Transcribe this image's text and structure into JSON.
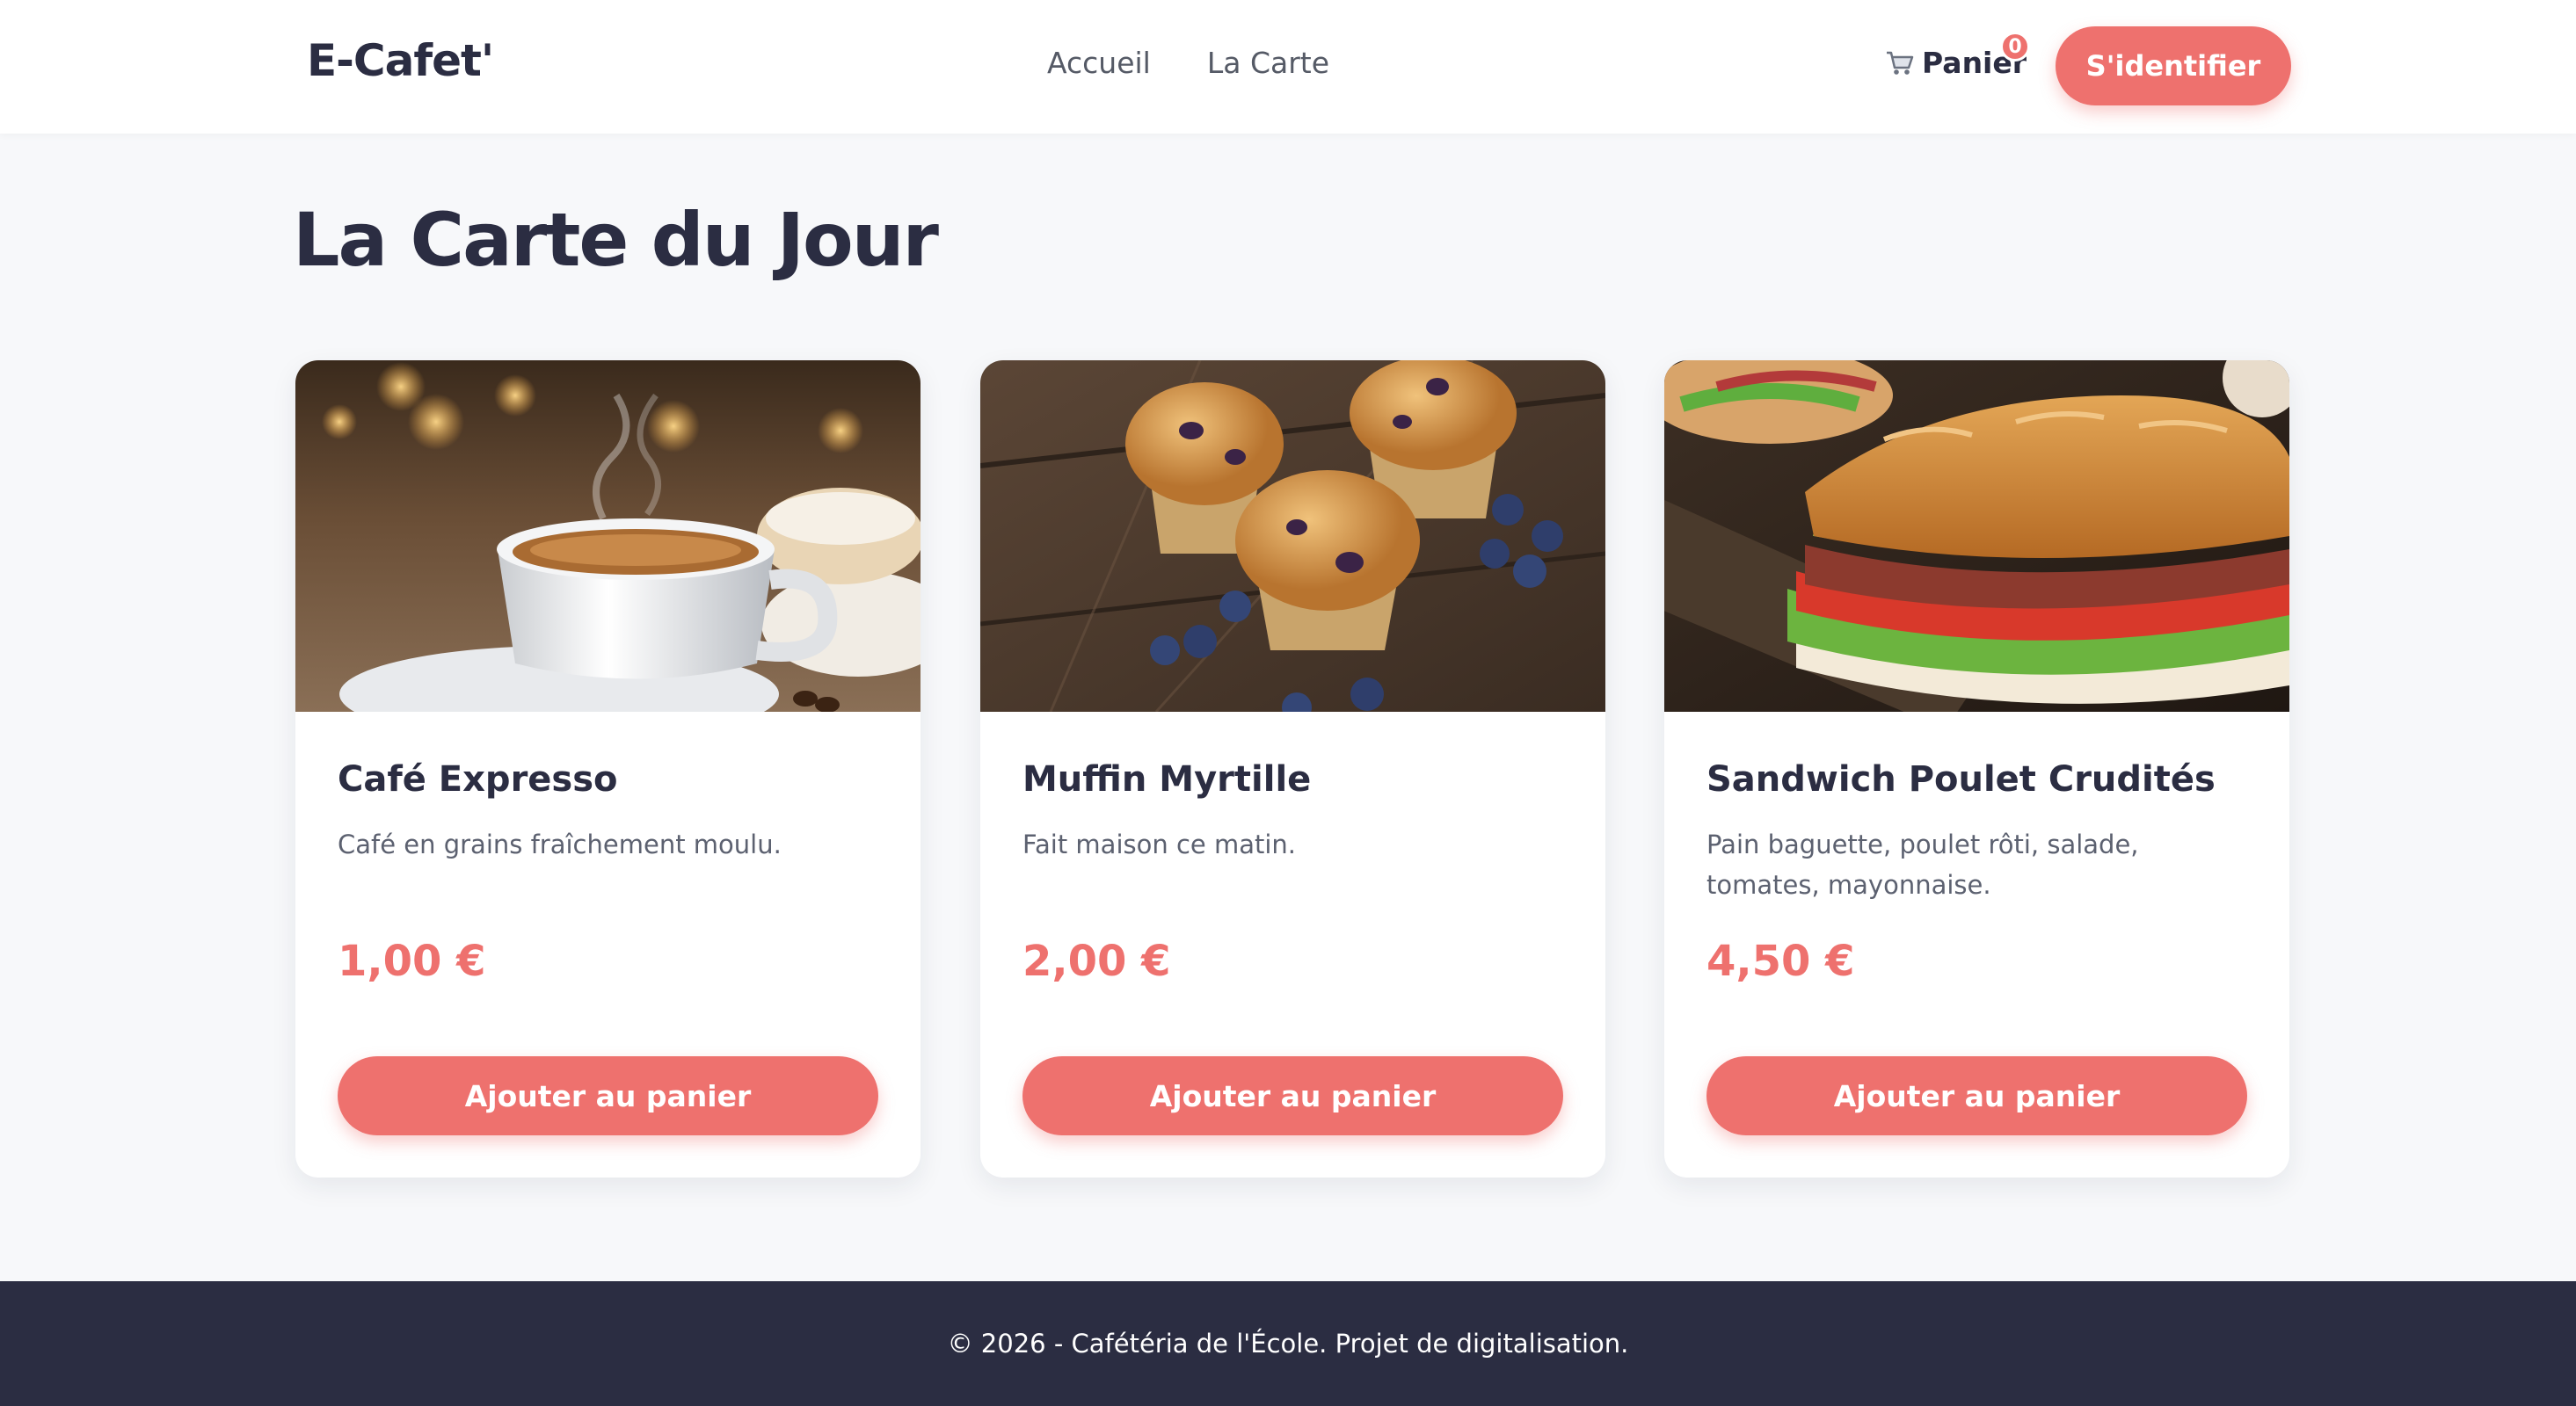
{
  "header": {
    "logo": "E-Cafet'",
    "nav": [
      "Accueil",
      "La Carte"
    ],
    "cart_label": "Panier",
    "cart_icon": "shopping-cart-icon",
    "cart_count": "0",
    "login_label": "S'identifier"
  },
  "main": {
    "title": "La Carte du Jour",
    "products": [
      {
        "name": "Café Expresso",
        "description": "Café en grains fraîchement moulu.",
        "price": "1,00 €",
        "button": "Ajouter au panier"
      },
      {
        "name": "Muffin Myrtille",
        "description": "Fait maison ce matin.",
        "price": "2,00 €",
        "button": "Ajouter au panier"
      },
      {
        "name": "Sandwich Poulet Crudités",
        "description": "Pain baguette, poulet rôti, salade, tomates, mayonnaise.",
        "price": "4,50 €",
        "button": "Ajouter au panier"
      }
    ]
  },
  "footer": {
    "text": "© 2026 - Cafétéria de l'École. Projet de digitalisation."
  },
  "colors": {
    "accent": "#ee716e",
    "dark": "#2b2d42",
    "background": "#f7f8fa"
  }
}
